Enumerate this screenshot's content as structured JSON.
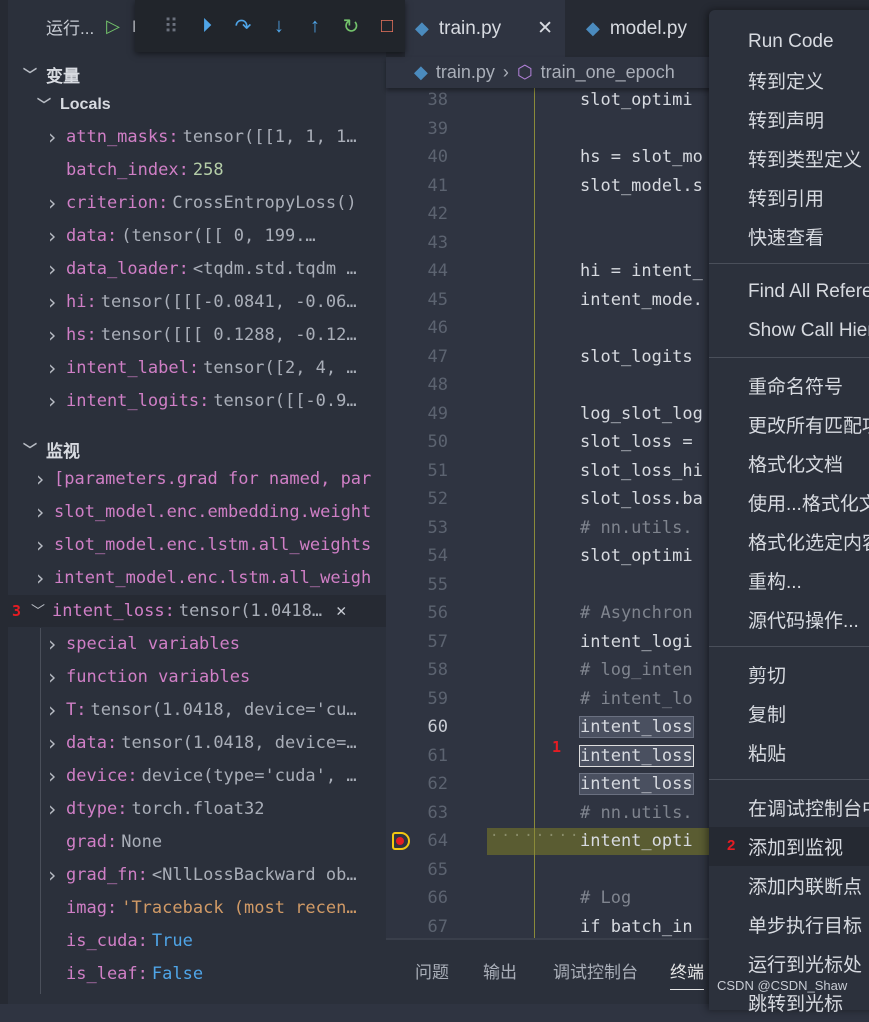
{
  "run": {
    "label": "运行...",
    "config_initial": "P"
  },
  "debug_toolbar": {
    "icons": [
      "drag-handle-icon",
      "continue-icon",
      "step-over-icon",
      "step-into-icon",
      "step-out-icon",
      "restart-icon",
      "stop-icon"
    ],
    "glyphs": [
      "⠿",
      "⏵",
      "↷",
      "↓",
      "↑",
      "↻",
      "□"
    ],
    "colors": [
      "#6b717d",
      "#4fa5e8",
      "#4fa5e8",
      "#4fa5e8",
      "#4fa5e8",
      "#73c26b",
      "#e8735d"
    ]
  },
  "variables": {
    "title": "变量",
    "scope": "Locals",
    "items": [
      {
        "name": "attn_masks",
        "value": "tensor([[1, 1, 1…",
        "expandable": true,
        "type": ""
      },
      {
        "name": "batch_index",
        "value": "258",
        "expandable": false,
        "type": "num"
      },
      {
        "name": "criterion",
        "value": "CrossEntropyLoss()",
        "expandable": true,
        "type": ""
      },
      {
        "name": "data",
        "value": "(tensor([[    0,  199.…",
        "expandable": true,
        "type": ""
      },
      {
        "name": "data_loader",
        "value": "<tqdm.std.tqdm …",
        "expandable": true,
        "type": ""
      },
      {
        "name": "hi",
        "value": "tensor([[[-0.0841, -0.06…",
        "expandable": true,
        "type": ""
      },
      {
        "name": "hs",
        "value": "tensor([[[ 0.1288, -0.12…",
        "expandable": true,
        "type": ""
      },
      {
        "name": "intent_label",
        "value": "tensor([2, 4, …",
        "expandable": true,
        "type": ""
      },
      {
        "name": "intent_logits",
        "value": "tensor([[-0.9…",
        "expandable": true,
        "type": ""
      }
    ]
  },
  "watch": {
    "title": "监视",
    "items": [
      "[parameters.grad for named, par",
      "slot_model.enc.embedding.weight",
      "slot_model.enc.lstm.all_weights",
      "intent_model.enc.lstm.all_weigh"
    ],
    "selected": {
      "badge": "3",
      "name": "intent_loss",
      "value": "tensor(1.0418…",
      "close": "✕"
    },
    "children": [
      {
        "name": "special variables",
        "value": "",
        "expandable": true,
        "type": ""
      },
      {
        "name": "function variables",
        "value": "",
        "expandable": true,
        "type": ""
      },
      {
        "name": "T",
        "value": "tensor(1.0418, device='cu…",
        "expandable": true,
        "type": ""
      },
      {
        "name": "data",
        "value": "tensor(1.0418, device=…",
        "expandable": true,
        "type": ""
      },
      {
        "name": "device",
        "value": "device(type='cuda', …",
        "expandable": true,
        "type": ""
      },
      {
        "name": "dtype",
        "value": "torch.float32",
        "expandable": true,
        "type": ""
      },
      {
        "name": "grad",
        "value": "None",
        "expandable": false,
        "type": ""
      },
      {
        "name": "grad_fn",
        "value": "<NllLossBackward ob…",
        "expandable": true,
        "type": ""
      },
      {
        "name": "imag",
        "value": "'Traceback (most recen…",
        "expandable": false,
        "type": "str"
      },
      {
        "name": "is_cuda",
        "value": "True",
        "expandable": false,
        "type": "kw"
      },
      {
        "name": "is_leaf",
        "value": "False",
        "expandable": false,
        "type": "kw"
      }
    ]
  },
  "tabs": [
    {
      "label": "train.py",
      "active": true,
      "close": "✕"
    },
    {
      "label": "model.py",
      "active": false
    }
  ],
  "breadcrumb": {
    "file": "train.py",
    "symbol": "train_one_epoch"
  },
  "editor": {
    "current_line": 64,
    "badge": "1",
    "lines": [
      {
        "n": 38,
        "t": "slot_optimi"
      },
      {
        "n": 39,
        "t": ""
      },
      {
        "n": 40,
        "t": "hs = slot_mo"
      },
      {
        "n": 41,
        "t": "slot_model.s"
      },
      {
        "n": 42,
        "t": ""
      },
      {
        "n": 43,
        "t": ""
      },
      {
        "n": 44,
        "t": "hi = intent_"
      },
      {
        "n": 45,
        "t": "intent_mode."
      },
      {
        "n": 46,
        "t": ""
      },
      {
        "n": 47,
        "t": "slot_logits"
      },
      {
        "n": 48,
        "t": ""
      },
      {
        "n": 49,
        "t": "log_slot_log"
      },
      {
        "n": 50,
        "t": "slot_loss ="
      },
      {
        "n": 51,
        "t": "slot_loss_hi"
      },
      {
        "n": 52,
        "t": "slot_loss.ba"
      },
      {
        "n": 53,
        "t": "# nn.utils."
      },
      {
        "n": 54,
        "t": "slot_optimi"
      },
      {
        "n": 55,
        "t": ""
      },
      {
        "n": 56,
        "t": "# Asynchron"
      },
      {
        "n": 57,
        "t": "intent_logi"
      },
      {
        "n": 58,
        "t": "# log_inten"
      },
      {
        "n": 59,
        "t": "# intent_lo"
      },
      {
        "n": 60,
        "t": "intent_loss"
      },
      {
        "n": 61,
        "t": "intent_loss"
      },
      {
        "n": 62,
        "t": "intent_loss"
      },
      {
        "n": 63,
        "t": "# nn.utils."
      },
      {
        "n": 64,
        "t": "intent_opti"
      },
      {
        "n": 65,
        "t": ""
      },
      {
        "n": 66,
        "t": "# Log"
      },
      {
        "n": 67,
        "t": "if batch_in"
      }
    ]
  },
  "panel_tabs": [
    {
      "label": "问题"
    },
    {
      "label": "输出"
    },
    {
      "label": "调试控制台"
    },
    {
      "label": "终端",
      "active": true
    }
  ],
  "context_menu": {
    "badge": "2",
    "highlighted": "添加到监视",
    "groups": [
      [
        "Run Code",
        "转到定义",
        "转到声明",
        "转到类型定义",
        "转到引用",
        "快速查看"
      ],
      [
        "Find All References",
        "Show Call Hierarchy"
      ],
      [
        "重命名符号",
        "更改所有匹配项",
        "格式化文档",
        "使用...格式化文档",
        "格式化选定内容",
        "重构...",
        "源代码操作..."
      ],
      [
        "剪切",
        "复制",
        "粘贴"
      ],
      [
        "在调试控制台中计算",
        "添加到监视",
        "添加内联断点",
        "单步执行目标",
        "运行到光标处",
        "跳转到光标"
      ]
    ]
  },
  "watermark": "CSDN @CSDN_Shaw",
  "colors": {
    "accent": "#4fa5e8",
    "breakpoint_line": "#5a5c32",
    "badge": "#e51c23"
  }
}
